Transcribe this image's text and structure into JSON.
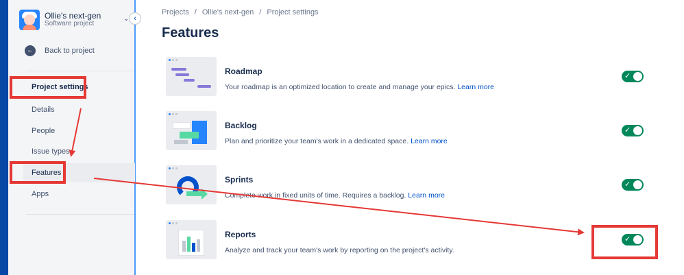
{
  "project": {
    "name": "Ollie's next-gen",
    "type": "Software project"
  },
  "sidebar": {
    "back_label": "Back to project",
    "heading": "Project settings",
    "items": [
      {
        "label": "Details"
      },
      {
        "label": "People"
      },
      {
        "label": "Issue types"
      },
      {
        "label": "Features",
        "selected": true
      },
      {
        "label": "Apps"
      }
    ]
  },
  "breadcrumb": {
    "items": [
      "Projects",
      "Ollie's next-gen",
      "Project settings"
    ],
    "separator": "/"
  },
  "page": {
    "title": "Features"
  },
  "features": [
    {
      "title": "Roadmap",
      "description": "Your roadmap is an optimized location to create and manage your epics.",
      "link": "Learn more",
      "enabled": true
    },
    {
      "title": "Backlog",
      "description": "Plan and prioritize your team's work in a dedicated space.",
      "link": "Learn more",
      "enabled": true
    },
    {
      "title": "Sprints",
      "description": "Complete work in fixed units of time. Requires a backlog.",
      "link": "Learn more",
      "enabled": true
    },
    {
      "title": "Reports",
      "description": "Analyze and track your team's work by reporting on the project's activity.",
      "link": "",
      "enabled": true
    }
  ],
  "icons": {
    "back": "arrow-left-icon",
    "collapse": "chevron-left-icon",
    "project_menu": "chevron-down-icon",
    "toggle_on": "check-icon"
  },
  "colors": {
    "toggle_on": "#00875a",
    "link": "#0052cc",
    "annotation": "#e53935",
    "rail": "#0747a6"
  }
}
